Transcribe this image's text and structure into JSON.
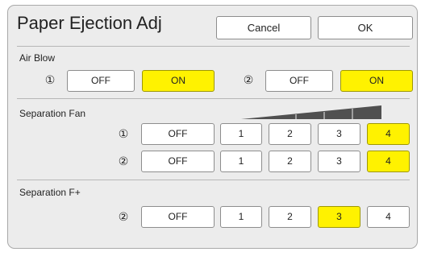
{
  "title": "Paper Ejection Adj",
  "header": {
    "cancel_label": "Cancel",
    "ok_label": "OK"
  },
  "air_blow": {
    "label": "Air Blow",
    "units": [
      {
        "marker": "①",
        "options": [
          "OFF",
          "ON"
        ],
        "selected": "ON"
      },
      {
        "marker": "②",
        "options": [
          "OFF",
          "ON"
        ],
        "selected": "ON"
      }
    ]
  },
  "separation_fan": {
    "label": "Separation Fan",
    "level_indicator_icon": "ramp-wedge-icon",
    "rows": [
      {
        "marker": "①",
        "options": [
          "OFF",
          "1",
          "2",
          "3",
          "4"
        ],
        "selected": "4"
      },
      {
        "marker": "②",
        "options": [
          "OFF",
          "1",
          "2",
          "3",
          "4"
        ],
        "selected": "4"
      }
    ]
  },
  "separation_f_plus": {
    "label": "Separation F+",
    "rows": [
      {
        "marker": "②",
        "options": [
          "OFF",
          "1",
          "2",
          "3",
          "4"
        ],
        "selected": "3"
      }
    ]
  },
  "colors": {
    "selected": "#fff200",
    "panel": "#ececec",
    "button": "#ffffff",
    "border": "#8d8d8d"
  }
}
